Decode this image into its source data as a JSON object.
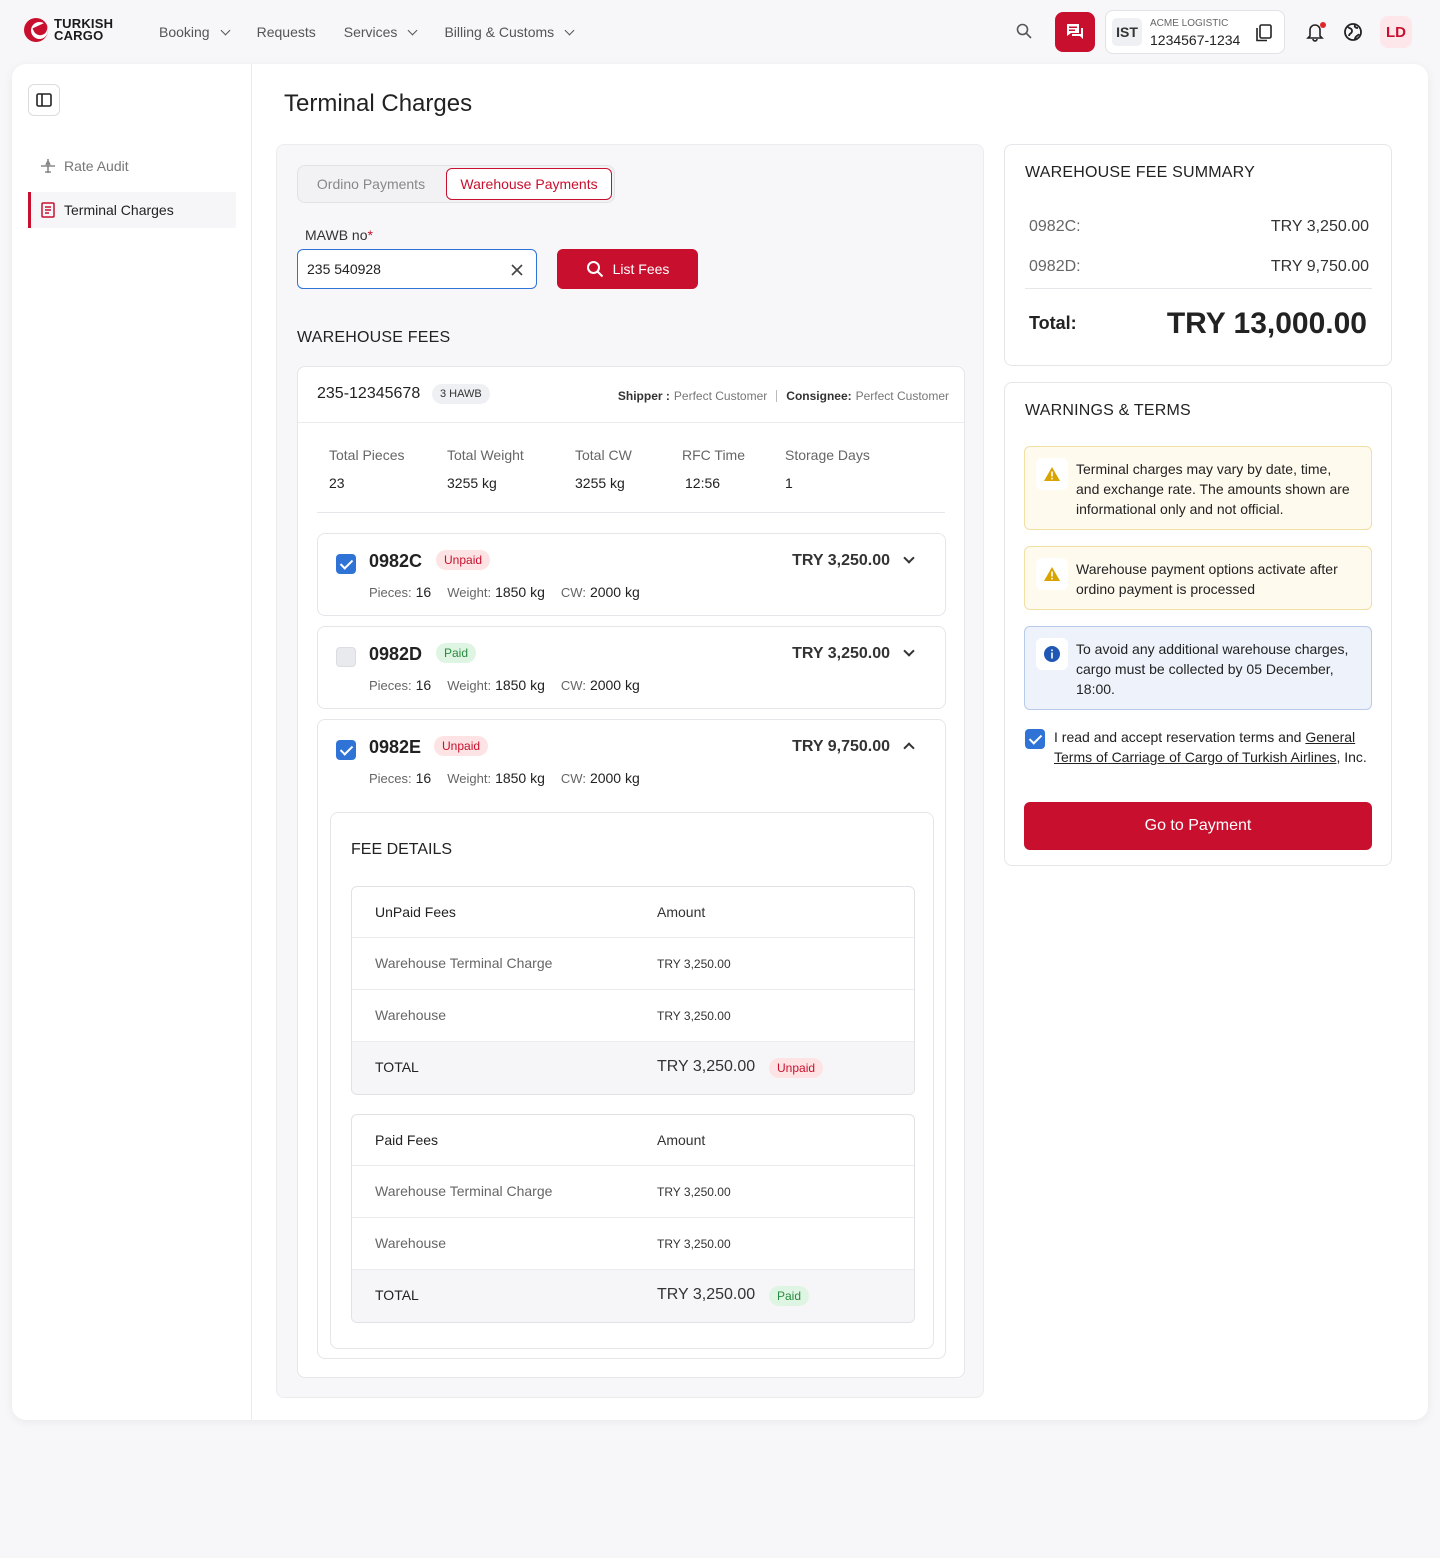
{
  "brand": {
    "line1": "TURKISH",
    "line2": "CARGO",
    "color": "#c8102e"
  },
  "nav": [
    {
      "label": "Booking",
      "dropdown": true
    },
    {
      "label": "Requests",
      "dropdown": false
    },
    {
      "label": "Services",
      "dropdown": true
    },
    {
      "label": "Billing & Customs",
      "dropdown": true
    }
  ],
  "account": {
    "station": "IST",
    "name": "ACME LOGISTIC",
    "number": "1234567-1234"
  },
  "user_initials": "LD",
  "sidebar": {
    "items": [
      {
        "label": "Rate Audit",
        "icon": "plane-icon"
      },
      {
        "label": "Terminal Charges",
        "icon": "receipt-icon",
        "active": true
      }
    ]
  },
  "page_title": "Terminal Charges",
  "tabs": {
    "ordino": "Ordino Payments",
    "warehouse": "Warehouse Payments"
  },
  "mawb": {
    "label": "MAWB no",
    "required": "*",
    "value": "235 540928"
  },
  "list_fees_label": "List Fees",
  "warehouse_fees": {
    "heading": "WAREHOUSE FEES",
    "awb": "235-12345678",
    "hawb_count": "3 HAWB",
    "shipper_label": "Shipper :",
    "shipper": "Perfect Customer",
    "consignee_label": "Consignee:",
    "consignee": "Perfect Customer",
    "stats": [
      {
        "label": "Total Pieces",
        "value": "23"
      },
      {
        "label": "Total Weight",
        "value": "3255 kg"
      },
      {
        "label": "Total CW",
        "value": "3255 kg"
      },
      {
        "label": "RFC Time",
        "value": "12:56"
      },
      {
        "label": "Storage Days",
        "value": "1"
      }
    ],
    "meta_labels": {
      "pieces": "Pieces:",
      "weight": "Weight:",
      "cw": "CW:"
    },
    "hawbs": [
      {
        "code": "0982C",
        "status": "Unpaid",
        "amount": "TRY 3,250.00",
        "checked": true,
        "expanded": false,
        "pieces": "16",
        "weight": "1850 kg",
        "cw": "2000 kg"
      },
      {
        "code": "0982D",
        "status": "Paid",
        "amount": "TRY 3,250.00",
        "checked": false,
        "expanded": false,
        "pieces": "16",
        "weight": "1850 kg",
        "cw": "2000 kg"
      },
      {
        "code": "0982E",
        "status": "Unpaid",
        "amount": "TRY 9,750.00",
        "checked": true,
        "expanded": true,
        "pieces": "16",
        "weight": "1850 kg",
        "cw": "2000 kg"
      }
    ],
    "fee_details": {
      "title": "FEE DETAILS",
      "unpaid": {
        "header": [
          "UnPaid Fees",
          "Amount"
        ],
        "rows": [
          [
            "Warehouse Terminal Charge",
            "TRY 3,250.00"
          ],
          [
            "Warehouse",
            "TRY 3,250.00"
          ]
        ],
        "total_label": "TOTAL",
        "total_value": "TRY 3,250.00",
        "total_badge": "Unpaid"
      },
      "paid": {
        "header": [
          "Paid Fees",
          "Amount"
        ],
        "rows": [
          [
            "Warehouse Terminal Charge",
            "TRY 3,250.00"
          ],
          [
            "Warehouse",
            "TRY 3,250.00"
          ]
        ],
        "total_label": "TOTAL",
        "total_value": "TRY 3,250.00",
        "total_badge": "Paid"
      }
    }
  },
  "summary": {
    "title": "WAREHOUSE FEE SUMMARY",
    "rows": [
      {
        "label": "0982C:",
        "value": "TRY 3,250.00"
      },
      {
        "label": "0982D:",
        "value": "TRY 9,750.00"
      }
    ],
    "total_label": "Total:",
    "total_value": "TRY 13,000.00"
  },
  "warnings": {
    "title": "WARNINGS & TERMS",
    "alerts": [
      {
        "type": "warning",
        "text": "Terminal charges may vary by date, time, and exchange rate. The amounts shown are informational only and not official."
      },
      {
        "type": "warning",
        "text": "Warehouse payment options activate after ordino payment is processed"
      },
      {
        "type": "info",
        "text": "To avoid any additional warehouse charges, cargo must be collected  by 05 December, 18:00."
      }
    ],
    "accept_prefix": "I read and accept reservation terms and ",
    "accept_link": "General Terms of Carriage of Cargo of Turkish Airlines",
    "accept_suffix": ", Inc.",
    "accepted": true
  },
  "pay_button": "Go to Payment"
}
